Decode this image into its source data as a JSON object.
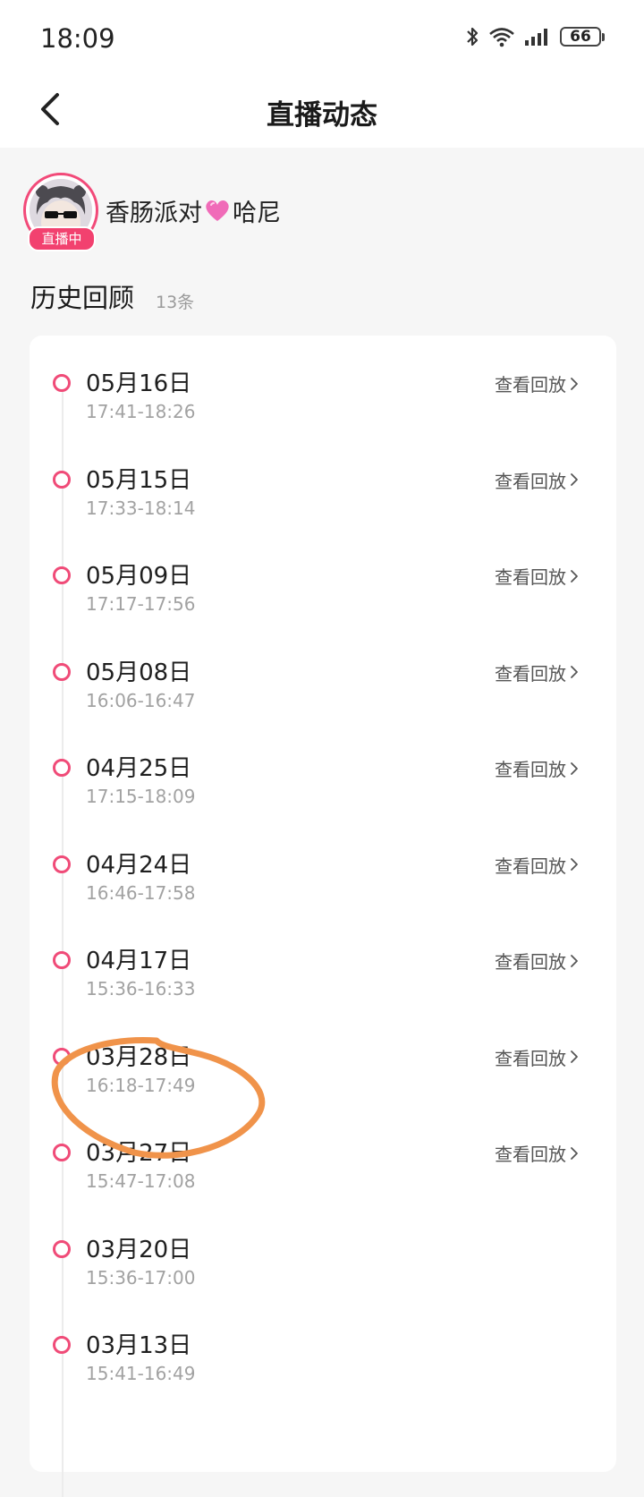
{
  "status_bar": {
    "time": "18:09",
    "battery": "66",
    "icons": [
      "bluetooth-icon",
      "wifi-icon",
      "signal-icon",
      "battery-icon"
    ]
  },
  "header": {
    "title": "直播动态",
    "back_icon": "back-arrow-icon"
  },
  "host": {
    "name_part1": "香肠派对",
    "name_part2": "哈尼",
    "live_badge": "直播中",
    "heart_icon": "pink-heart-icon"
  },
  "history": {
    "title": "历史回顾",
    "count": "13条",
    "items": [
      {
        "date": "05月16日",
        "time": "17:41-18:26",
        "replay": "查看回放"
      },
      {
        "date": "05月15日",
        "time": "17:33-18:14",
        "replay": "查看回放"
      },
      {
        "date": "05月09日",
        "time": "17:17-17:56",
        "replay": "查看回放"
      },
      {
        "date": "05月08日",
        "time": "16:06-16:47",
        "replay": "查看回放"
      },
      {
        "date": "04月25日",
        "time": "17:15-18:09",
        "replay": "查看回放"
      },
      {
        "date": "04月24日",
        "time": "16:46-17:58",
        "replay": "查看回放"
      },
      {
        "date": "04月17日",
        "time": "15:36-16:33",
        "replay": "查看回放"
      },
      {
        "date": "03月28日",
        "time": "16:18-17:49",
        "replay": "查看回放"
      },
      {
        "date": "03月27日",
        "time": "15:47-17:08",
        "replay": "查看回放"
      },
      {
        "date": "03月20日",
        "time": "15:36-17:00",
        "replay": ""
      },
      {
        "date": "03月13日",
        "time": "15:41-16:49",
        "replay": ""
      }
    ]
  },
  "colors": {
    "accent_pink": "#f04b78",
    "annotation_orange": "#f0934a"
  }
}
